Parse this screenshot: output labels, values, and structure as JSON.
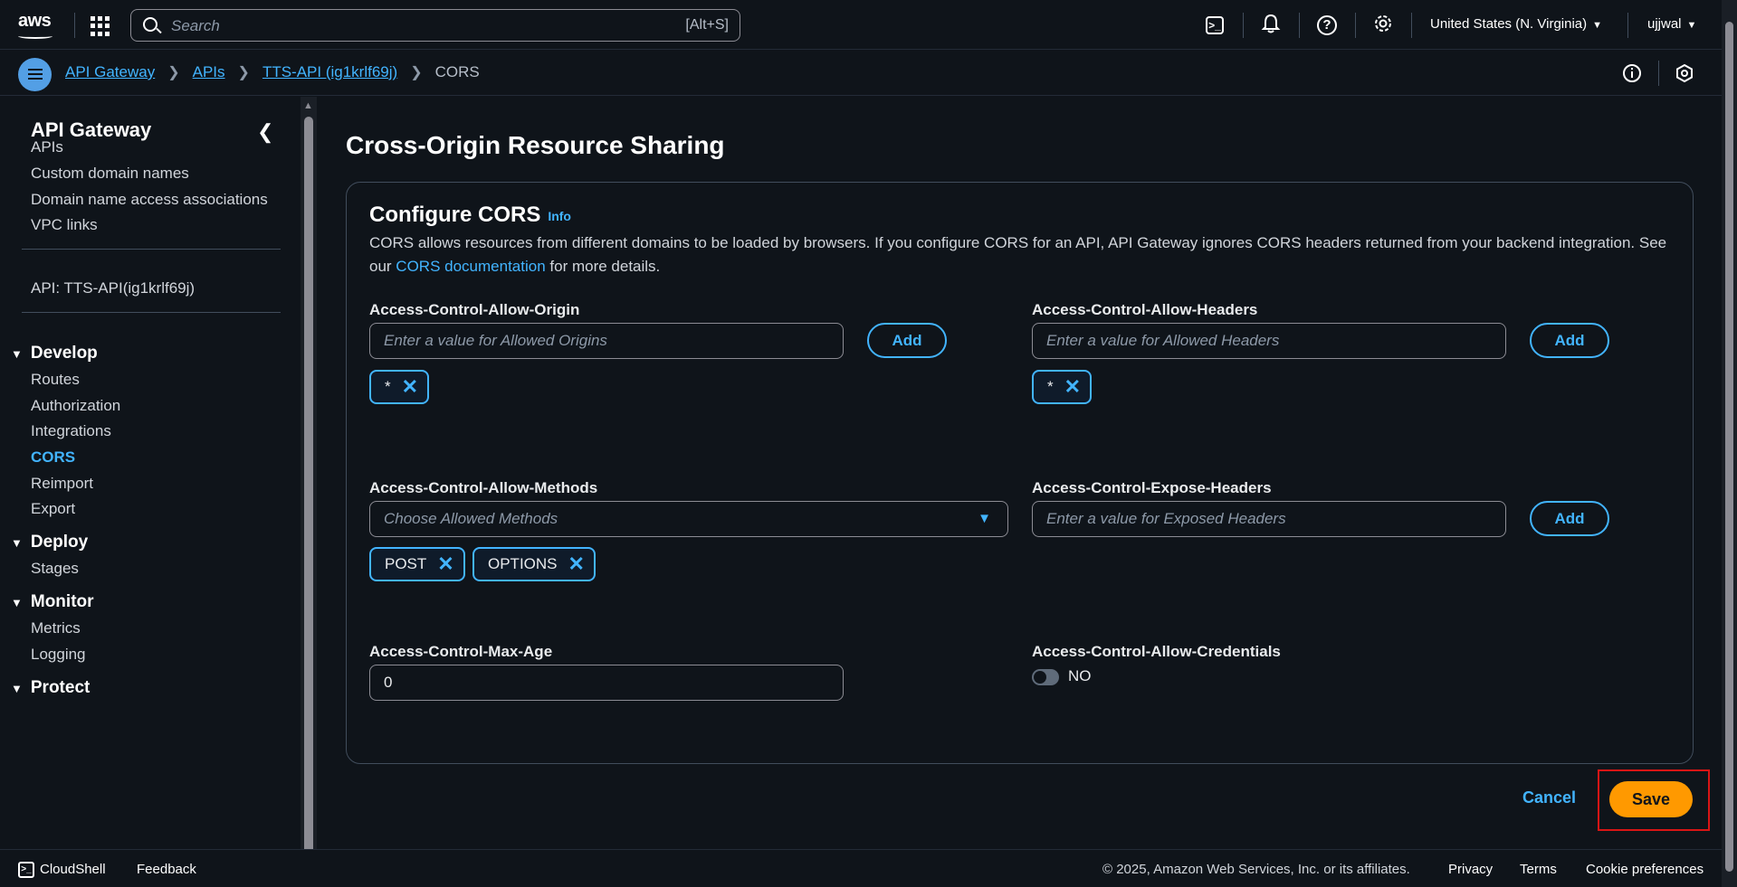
{
  "topnav": {
    "logo": "aws",
    "search_placeholder": "Search",
    "search_shortcut": "[Alt+S]",
    "region": "United States (N. Virginia)",
    "user": "ujjwal",
    "icons": [
      "cloudshell-icon",
      "bell-icon",
      "help-icon",
      "gear-icon"
    ]
  },
  "breadcrumb": {
    "items": [
      "API Gateway",
      "APIs",
      "TTS-API (ig1krlf69j)"
    ],
    "current": "CORS"
  },
  "sidebar": {
    "title": "API Gateway",
    "top_items": [
      "APIs",
      "Custom domain names",
      "Domain name access associations",
      "VPC links"
    ],
    "api_label": "API: TTS-API(ig1krlf69j)",
    "sections": [
      {
        "title": "Develop",
        "items": [
          "Routes",
          "Authorization",
          "Integrations",
          "CORS",
          "Reimport",
          "Export"
        ]
      },
      {
        "title": "Deploy",
        "items": [
          "Stages"
        ]
      },
      {
        "title": "Monitor",
        "items": [
          "Metrics",
          "Logging"
        ]
      },
      {
        "title": "Protect",
        "items": []
      }
    ],
    "active_item": "CORS"
  },
  "page": {
    "title": "Cross-Origin Resource Sharing",
    "panel_title": "Configure CORS",
    "info_label": "Info",
    "desc_before": "CORS allows resources from different domains to be loaded by browsers. If you configure CORS for an API, API Gateway ignores CORS headers returned from your backend integration. See our ",
    "desc_link": "CORS documentation",
    "desc_after": " for more details."
  },
  "fields": {
    "allow_origin": {
      "label": "Access-Control-Allow-Origin",
      "placeholder": "Enter a value for Allowed Origins",
      "add": "Add",
      "tokens": [
        "*"
      ]
    },
    "allow_headers": {
      "label": "Access-Control-Allow-Headers",
      "placeholder": "Enter a value for Allowed Headers",
      "add": "Add",
      "tokens": [
        "*"
      ]
    },
    "allow_methods": {
      "label": "Access-Control-Allow-Methods",
      "placeholder": "Choose Allowed Methods",
      "tokens": [
        "POST",
        "OPTIONS"
      ]
    },
    "expose_headers": {
      "label": "Access-Control-Expose-Headers",
      "placeholder": "Enter a value for Exposed Headers",
      "add": "Add"
    },
    "max_age": {
      "label": "Access-Control-Max-Age",
      "value": "0"
    },
    "allow_credentials": {
      "label": "Access-Control-Allow-Credentials",
      "state": "NO"
    }
  },
  "actions": {
    "cancel": "Cancel",
    "save": "Save"
  },
  "footer": {
    "cloudshell": "CloudShell",
    "feedback": "Feedback",
    "copyright": "© 2025, Amazon Web Services, Inc. or its affiliates.",
    "links": [
      "Privacy",
      "Terms",
      "Cookie preferences"
    ]
  },
  "colors": {
    "accent": "#42b4ff",
    "save": "#ff9900",
    "highlight_border": "#d91515",
    "background": "#0f141a"
  }
}
